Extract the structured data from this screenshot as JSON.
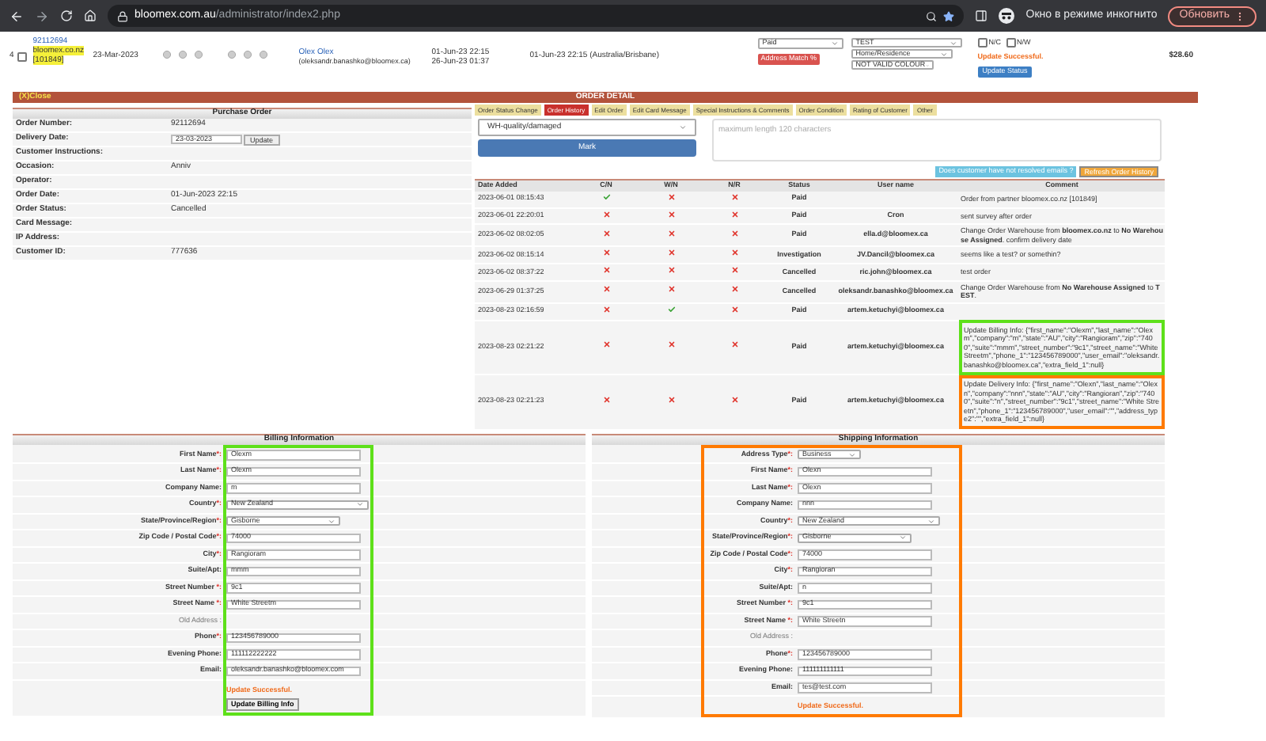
{
  "browser": {
    "host": "bloomex.com.au",
    "path": "/administrator/index2.php",
    "incognito": "Окно в режиме инкогнито",
    "update_button": "Обновить"
  },
  "order_row": {
    "index": "4",
    "checked": false,
    "order_id": "92112694",
    "site": "bloomex.co.nz",
    "partner_id": "[101849]",
    "date": "23-Mar-2023",
    "customer_name": "Olex Olex",
    "customer_email": "(oleksandr.banashko@bloomex.ca)",
    "dates": [
      "01-Jun-23 22:15",
      "26-Jun-23 01:37"
    ],
    "local_date": "01-Jun-23 22:15 (Australia/Brisbane)",
    "status": "Paid",
    "address_match": "Address Match %",
    "warehouse": "TEST",
    "address_type": "Home/Residence",
    "colour": "NOT VALID COLOUR",
    "flags": [
      {
        "label": "N/C",
        "checked": false
      },
      {
        "label": "N/W",
        "checked": false
      }
    ],
    "message": "Update Successful.",
    "update_button": "Update Status",
    "total": "$28.60"
  },
  "order_detail": {
    "close": "(X)Close",
    "title": "ORDER DETAIL"
  },
  "purchase_order": {
    "title": "Purchase Order",
    "fields": [
      {
        "label": "Order Number:",
        "value": "92112694"
      },
      {
        "label": "Delivery Date:",
        "value": "23-03-2023",
        "kind": "date",
        "button": "Update"
      },
      {
        "label": "Customer Instructions:"
      },
      {
        "label": "Occasion:",
        "value": "Anniv"
      },
      {
        "label": "Operator:"
      },
      {
        "label": "Order Date:",
        "value": "01-Jun-2023 22:15"
      },
      {
        "label": "Order Status:",
        "value": "Cancelled"
      },
      {
        "label": "Card Message:"
      },
      {
        "label": "IP Address:"
      },
      {
        "label": "Customer ID:",
        "value": "777636"
      }
    ]
  },
  "tabs": [
    {
      "label": "Order Status Change",
      "selected": false
    },
    {
      "label": "Order History",
      "selected": true
    },
    {
      "label": "Edit Order",
      "selected": false
    },
    {
      "label": "Edit Card Message",
      "selected": false
    },
    {
      "label": "Special Instructions & Comments",
      "selected": false
    },
    {
      "label": "Order Condition",
      "selected": false
    },
    {
      "label": "Rating of Customer",
      "selected": false
    },
    {
      "label": "Other",
      "selected": false
    }
  ],
  "mark_form": {
    "reason": "WH-quality/damaged",
    "button": "Mark",
    "placeholder": "maximum length 120 characters"
  },
  "history_buttons": [
    {
      "label": "Does customer have not resolved emails ?",
      "kind": "info"
    },
    {
      "label": "Refresh Order History",
      "kind": "warning"
    }
  ],
  "history": {
    "columns": [
      "Date Added",
      "C/N",
      "W/N",
      "N/R",
      "Status",
      "User name",
      "Comment"
    ],
    "rows": [
      {
        "date": "2023-06-01 08:15:43",
        "cn": true,
        "wn": false,
        "nr": false,
        "status": "Paid",
        "comment": "Order from partner bloomex.co.nz [101849]"
      },
      {
        "date": "2023-06-01 22:20:01",
        "cn": false,
        "wn": false,
        "nr": false,
        "status": "Paid",
        "user": "Cron",
        "comment": "sent survey after order"
      },
      {
        "date": "2023-06-02 08:02:05",
        "cn": false,
        "wn": false,
        "nr": false,
        "status": "Paid",
        "user": "ella.d@bloomex.ca",
        "comment": "Change Order Warehouse from **bloomex.co.nz** to **No Warehouse Assigned**. confirm delivery date"
      },
      {
        "date": "2023-06-02 08:15:14",
        "cn": false,
        "wn": false,
        "nr": false,
        "status": "Investigation",
        "user": "JV.Dancil@bloomex.ca",
        "comment": "seems like a test? or somethin?"
      },
      {
        "date": "2023-06-02 08:37:22",
        "cn": false,
        "wn": false,
        "nr": false,
        "status": "Cancelled",
        "user": "ric.john@bloomex.ca",
        "comment": "test order"
      },
      {
        "date": "2023-06-29 01:37:25",
        "cn": false,
        "wn": false,
        "nr": false,
        "status": "Cancelled",
        "user": "oleksandr.banashko@bloomex.ca",
        "comment": "Change Order Warehouse from **No Warehouse Assigned** to **TEST**."
      },
      {
        "date": "2023-08-23 02:16:59",
        "cn": false,
        "wn": true,
        "nr": false,
        "status": "Paid",
        "user": "artem.ketuchyi@bloomex.ca"
      },
      {
        "date": "2023-08-23 02:21:22",
        "cn": false,
        "wn": false,
        "nr": false,
        "status": "Paid",
        "user": "artem.ketuchyi@bloomex.ca",
        "comment": "Update Billing Info: {\"first_name\":\"Olexm\",\"last_name\":\"Olexm\",\"company\":\"m\",\"state\":\"AU\",\"city\":\"Rangioram\",\"zip\":\"7400\",\"suite\":\"mmm\",\"street_number\":\"9c1\",\"street_name\":\"White Streetm\",\"phone_1\":\"123456789000\",\"user_email\":\"oleksandr.banashko@bloomex.ca\",\"extra_field_1\":null}",
        "color": "#5ee01a"
      },
      {
        "date": "2023-08-23 02:21:23",
        "cn": false,
        "wn": false,
        "nr": false,
        "status": "Paid",
        "user": "artem.ketuchyi@bloomex.ca",
        "comment": "Update Delivery Info: {\"first_name\":\"Olexn\",\"last_name\":\"Olexn\",\"company\":\"nnn\",\"state\":\"AU\",\"city\":\"Rangioran\",\"zip\":\"7400\",\"suite\":\"n\",\"street_number\":\"9c1\",\"street_name\":\"White Streetn\",\"phone_1\":\"123456789000\",\"user_email\":\"\",\"address_type2\":\"\",\"extra_field_1\":null}",
        "color": "#ff7a00"
      }
    ]
  },
  "billing": {
    "title": "Billing Information",
    "color": "#5ee01a",
    "fields": [
      {
        "label": "First Name",
        "star": "*:",
        "value": "Olexm"
      },
      {
        "label": "Last Name",
        "star": "*:",
        "value": "Olexm"
      },
      {
        "label": "Company Name:",
        "value": "m"
      },
      {
        "label": "Country",
        "star": "*:",
        "value": "New Zealand",
        "kind": "select"
      },
      {
        "label": "State/Province/Region",
        "star": "*:",
        "value": "Gisborne",
        "kind": "select"
      },
      {
        "label": "Zip Code / Postal Code",
        "star": "*:",
        "value": "74000"
      },
      {
        "label": "City",
        "star": "*:",
        "value": "Rangioram"
      },
      {
        "label": "Suite/Apt:",
        "value": "mmm"
      },
      {
        "label": "Street Number ",
        "star": "*:",
        "value": "9c1"
      },
      {
        "label": "Street Name ",
        "star": "*:",
        "value": "White Streetm"
      },
      {
        "label": "Old Address :",
        "kind": "note"
      },
      {
        "label": "Phone",
        "star": "*:",
        "value": "123456789000"
      },
      {
        "label": "Evening Phone:",
        "value": "111112222222"
      },
      {
        "label": "Email:",
        "value": "oleksandr.banashko@bloomex.com"
      }
    ],
    "message": "Update Successful.",
    "button": "Update Billing Info"
  },
  "shipping": {
    "title": "Shipping Information",
    "color": "#ff7a00",
    "fields": [
      {
        "label": "Address Type",
        "star": "*:",
        "value": "Business",
        "kind": "select"
      },
      {
        "label": "First Name",
        "star": "*:",
        "value": "Olexn"
      },
      {
        "label": "Last Name",
        "star": "*:",
        "value": "Olexn"
      },
      {
        "label": "Company Name:",
        "value": "nnn"
      },
      {
        "label": "Country",
        "star": "*:",
        "value": "New Zealand",
        "kind": "select"
      },
      {
        "label": "State/Province/Region",
        "star": "*:",
        "value": "Gisborne",
        "kind": "select"
      },
      {
        "label": "Zip Code / Postal Code",
        "star": "*:",
        "value": "74000"
      },
      {
        "label": "City",
        "star": "*:",
        "value": "Rangioran"
      },
      {
        "label": "Suite/Apt:",
        "value": "n"
      },
      {
        "label": "Street Number ",
        "star": "*:",
        "value": "9c1"
      },
      {
        "label": "Street Name ",
        "star": "*:",
        "value": "White Streetn"
      },
      {
        "label": "Old Address :",
        "kind": "note"
      },
      {
        "label": "Phone",
        "star": "*:",
        "value": "123456789000"
      },
      {
        "label": "Evening Phone:",
        "value": "111111111111"
      },
      {
        "label": "Email:",
        "value": "tes@test.com"
      }
    ],
    "message": "Update Successful."
  }
}
